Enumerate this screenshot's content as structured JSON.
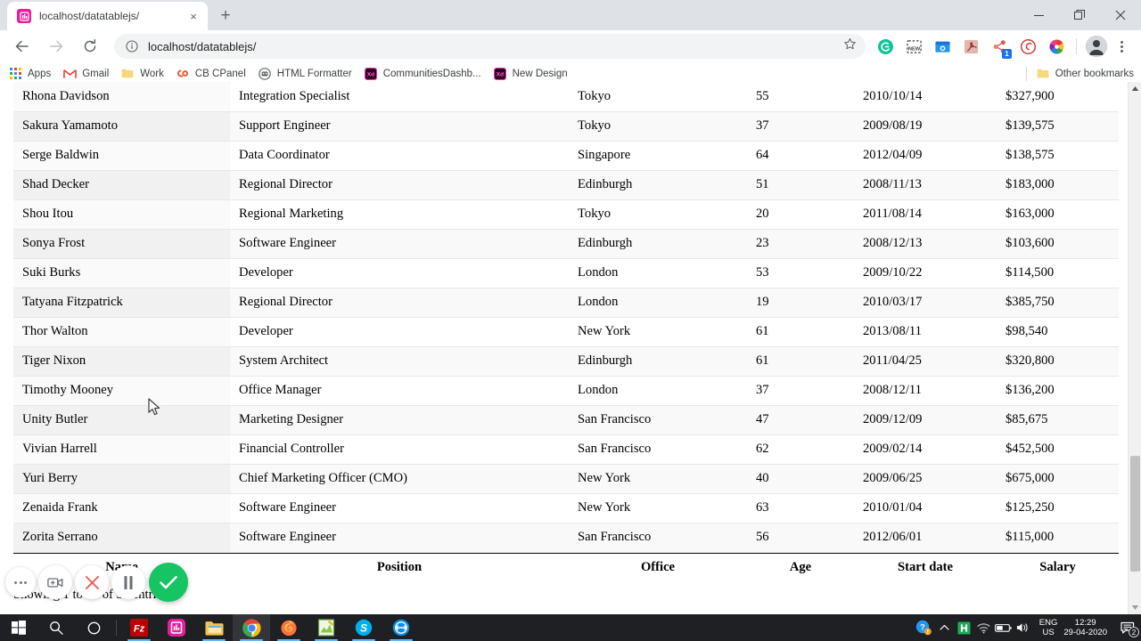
{
  "browser": {
    "tab": {
      "title": "localhost/datatablejs/",
      "favicon_name": "datatable-favicon",
      "close_label": "×"
    },
    "newtab_label": "+",
    "window_controls": {
      "minimize": "—",
      "maximize": "❐",
      "close": "✕"
    },
    "toolbar": {
      "back_label": "←",
      "forward_label": "→",
      "reload_label": "⟳",
      "url": "localhost/datatablejs/",
      "info_label": "ⓘ",
      "star_label": "☆",
      "extensions": [
        {
          "name": "grammarly-extension",
          "badge": ""
        },
        {
          "name": "newsguard-extension",
          "badge": ""
        },
        {
          "name": "screen-capture-extension",
          "badge": ""
        },
        {
          "name": "adobe-acrobat-extension",
          "badge": ""
        },
        {
          "name": "share-extension",
          "badge": "1"
        },
        {
          "name": "evernote-extension",
          "badge": ""
        },
        {
          "name": "color-picker-extension",
          "badge": ""
        }
      ]
    },
    "bookmarks": [
      {
        "label": "Apps",
        "icon": "apps-grid-icon"
      },
      {
        "label": "Gmail",
        "icon": "gmail-icon"
      },
      {
        "label": "Work",
        "icon": "folder-icon"
      },
      {
        "label": "CB CPanel",
        "icon": "cpanel-icon"
      },
      {
        "label": "HTML Formatter",
        "icon": "html-formatter-icon"
      },
      {
        "label": "CommunitiesDashb...",
        "icon": "adobe-xd-icon"
      },
      {
        "label": "New Design",
        "icon": "adobe-xd-icon"
      }
    ],
    "other_bookmarks": {
      "label": "Other bookmarks",
      "icon": "folder-icon"
    }
  },
  "table": {
    "columns": [
      "Name",
      "Position",
      "Office",
      "Age",
      "Start date",
      "Salary"
    ],
    "rows": [
      {
        "name": "Rhona Davidson",
        "position": "Integration Specialist",
        "office": "Tokyo",
        "age": "55",
        "start": "2010/10/14",
        "salary": "$327,900"
      },
      {
        "name": "Sakura Yamamoto",
        "position": "Support Engineer",
        "office": "Tokyo",
        "age": "37",
        "start": "2009/08/19",
        "salary": "$139,575"
      },
      {
        "name": "Serge Baldwin",
        "position": "Data Coordinator",
        "office": "Singapore",
        "age": "64",
        "start": "2012/04/09",
        "salary": "$138,575"
      },
      {
        "name": "Shad Decker",
        "position": "Regional Director",
        "office": "Edinburgh",
        "age": "51",
        "start": "2008/11/13",
        "salary": "$183,000"
      },
      {
        "name": "Shou Itou",
        "position": "Regional Marketing",
        "office": "Tokyo",
        "age": "20",
        "start": "2011/08/14",
        "salary": "$163,000"
      },
      {
        "name": "Sonya Frost",
        "position": "Software Engineer",
        "office": "Edinburgh",
        "age": "23",
        "start": "2008/12/13",
        "salary": "$103,600"
      },
      {
        "name": "Suki Burks",
        "position": "Developer",
        "office": "London",
        "age": "53",
        "start": "2009/10/22",
        "salary": "$114,500"
      },
      {
        "name": "Tatyana Fitzpatrick",
        "position": "Regional Director",
        "office": "London",
        "age": "19",
        "start": "2010/03/17",
        "salary": "$385,750"
      },
      {
        "name": "Thor Walton",
        "position": "Developer",
        "office": "New York",
        "age": "61",
        "start": "2013/08/11",
        "salary": "$98,540"
      },
      {
        "name": "Tiger Nixon",
        "position": "System Architect",
        "office": "Edinburgh",
        "age": "61",
        "start": "2011/04/25",
        "salary": "$320,800"
      },
      {
        "name": "Timothy Mooney",
        "position": "Office Manager",
        "office": "London",
        "age": "37",
        "start": "2008/12/11",
        "salary": "$136,200"
      },
      {
        "name": "Unity Butler",
        "position": "Marketing Designer",
        "office": "San Francisco",
        "age": "47",
        "start": "2009/12/09",
        "salary": "$85,675"
      },
      {
        "name": "Vivian Harrell",
        "position": "Financial Controller",
        "office": "San Francisco",
        "age": "62",
        "start": "2009/02/14",
        "salary": "$452,500"
      },
      {
        "name": "Yuri Berry",
        "position": "Chief Marketing Officer (CMO)",
        "office": "New York",
        "age": "40",
        "start": "2009/06/25",
        "salary": "$675,000"
      },
      {
        "name": "Zenaida Frank",
        "position": "Software Engineer",
        "office": "New York",
        "age": "63",
        "start": "2010/01/04",
        "salary": "$125,250"
      },
      {
        "name": "Zorita Serrano",
        "position": "Software Engineer",
        "office": "San Francisco",
        "age": "56",
        "start": "2012/06/01",
        "salary": "$115,000"
      }
    ],
    "info": "Showing 1 to 57 of 57 entries"
  },
  "recorder": {
    "buttons": [
      {
        "name": "more-options-button",
        "icon": "ellipsis-icon"
      },
      {
        "name": "add-camera-button",
        "icon": "camera-plus-icon"
      },
      {
        "name": "stop-button",
        "icon": "close-x-icon"
      },
      {
        "name": "pause-button",
        "icon": "pause-icon"
      },
      {
        "name": "confirm-button",
        "icon": "checkmark-icon"
      }
    ],
    "accent_color": "#16c464",
    "stop_color": "#ef5350"
  },
  "taskbar": {
    "items": [
      {
        "name": "start-button",
        "icon": "windows-logo-icon"
      },
      {
        "name": "search-button",
        "icon": "search-icon"
      },
      {
        "name": "cortana-button",
        "icon": "cortana-circle-icon"
      },
      {
        "name": "taskbar-app-filezilla",
        "icon": "filezilla-icon"
      },
      {
        "name": "taskbar-app-magenta",
        "icon": "magenta-app-icon"
      },
      {
        "name": "taskbar-app-explorer",
        "icon": "file-explorer-icon"
      },
      {
        "name": "taskbar-app-chrome",
        "icon": "chrome-icon"
      },
      {
        "name": "taskbar-app-firefox",
        "icon": "firefox-icon"
      },
      {
        "name": "taskbar-app-notepadpp",
        "icon": "notepad-plus-plus-icon"
      },
      {
        "name": "taskbar-app-skype",
        "icon": "skype-icon"
      },
      {
        "name": "taskbar-app-teamviewer",
        "icon": "teamviewer-icon"
      }
    ],
    "tray": {
      "help_icon": "help-warning-icon",
      "chevron": "∧",
      "app_icon": "green-app-icon",
      "network_icon": "wifi-icon",
      "battery_icon": "battery-icon",
      "volume_icon": "speaker-icon",
      "language_line1": "ENG",
      "language_line2": "US",
      "time": "12:29",
      "date": "29-04-2020",
      "notification_count": "2"
    }
  }
}
